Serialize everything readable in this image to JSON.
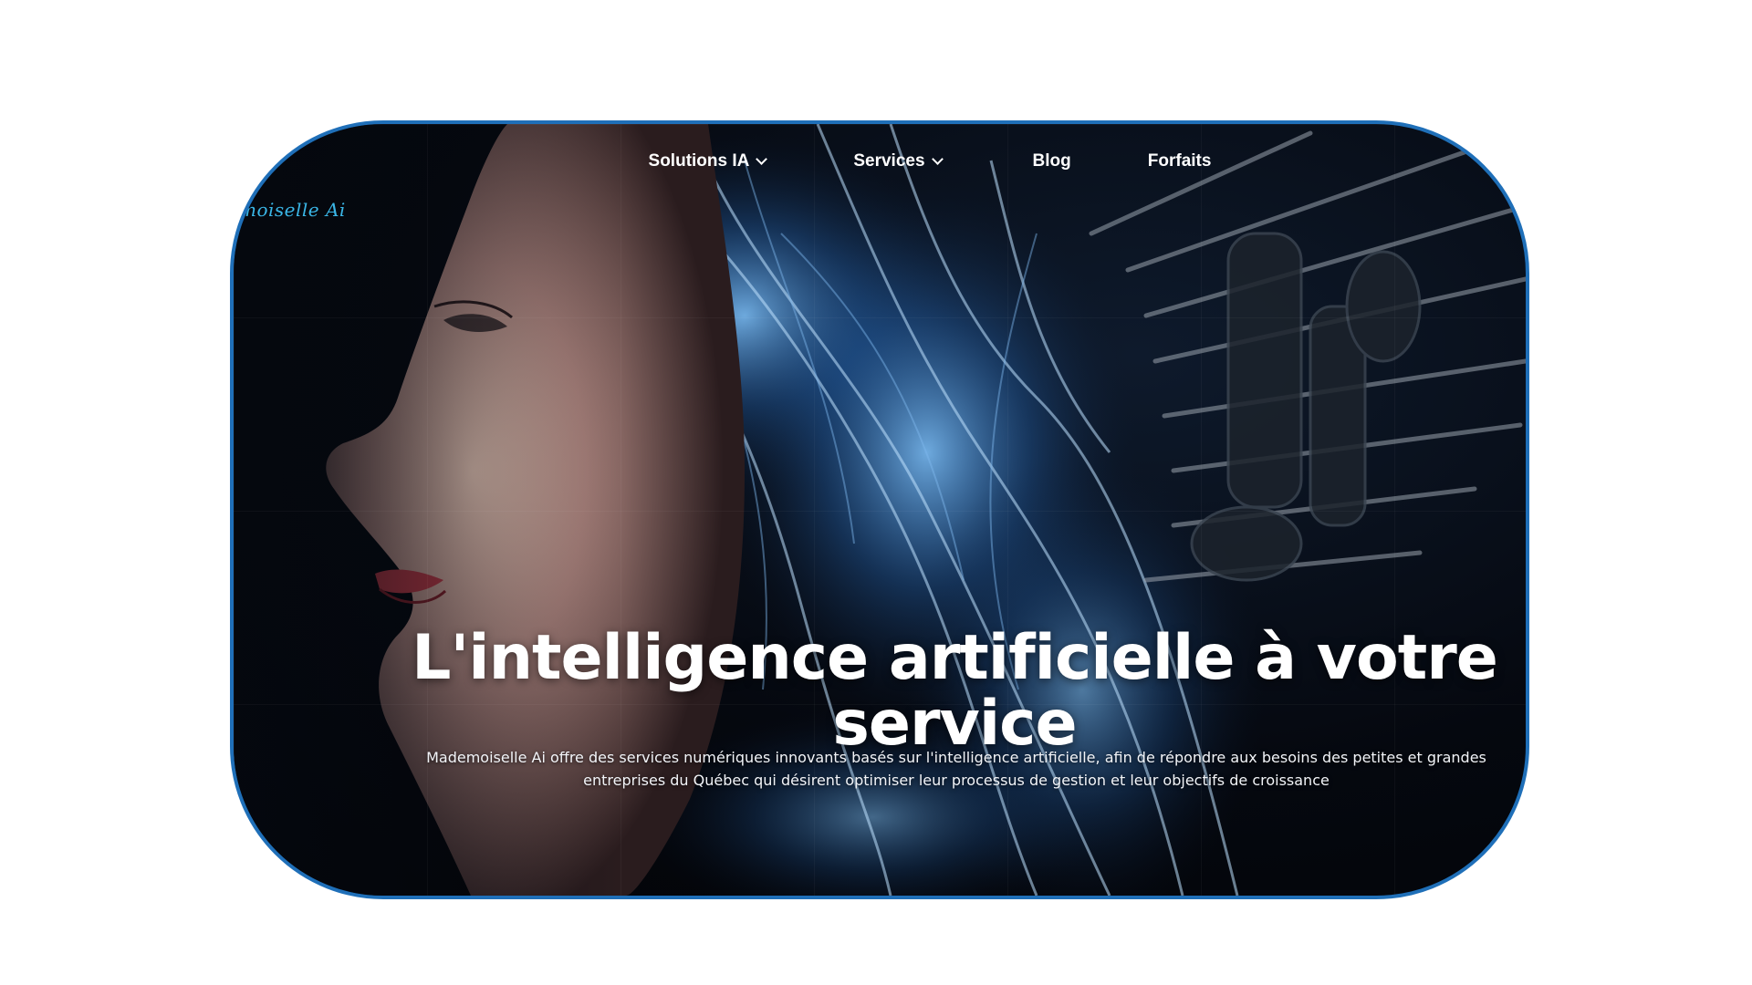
{
  "brand": {
    "logo_text": "moiselle Ai"
  },
  "nav": {
    "items": [
      {
        "label": "Solutions IA",
        "has_dropdown": true
      },
      {
        "label": "Services",
        "has_dropdown": true
      },
      {
        "label": "Blog",
        "has_dropdown": false
      },
      {
        "label": "Forfaits",
        "has_dropdown": false
      }
    ]
  },
  "hero": {
    "headline": "L'intelligence artificielle à votre service",
    "subtitle": "Mademoiselle Ai offre des services numériques innovants basés sur l'intelligence artificielle, afin de répondre aux besoins des petites et grandes entreprises du Québec qui désirent optimiser leur processus de gestion et leur objectifs de croissance"
  },
  "colors": {
    "frame_border": "#1f6fb8",
    "logo": "#3ab6e6",
    "background": "#05080f",
    "glow": "#3a8fe0"
  }
}
